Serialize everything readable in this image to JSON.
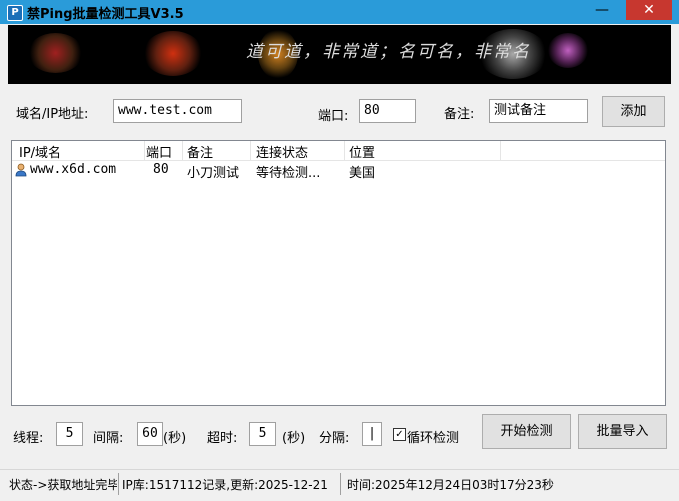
{
  "window": {
    "title": "禁Ping批量检测工具V3.5",
    "icon_letter": "P",
    "minimize": "—",
    "close": "✕"
  },
  "banner": {
    "calligraphy": "道可道，非常道；名可名，非常名"
  },
  "form": {
    "domain_label": "域名/IP地址:",
    "domain_value": "www.test.com",
    "port_label": "端口:",
    "port_value": "80",
    "remark_label": "备注:",
    "remark_value": "测试备注",
    "add_button": "添加"
  },
  "table": {
    "columns": [
      "IP/域名",
      "端口",
      "备注",
      "连接状态",
      "位置"
    ],
    "rows": [
      {
        "host": "www.x6d.com",
        "port": "80",
        "remark": "小刀测试",
        "status": "等待检测...",
        "location": "美国"
      }
    ]
  },
  "controls": {
    "threads_label": "线程:",
    "threads_value": "5",
    "interval_label": "间隔:",
    "interval_value": "60",
    "interval_unit": "(秒)",
    "timeout_label": "超时:",
    "timeout_value": "5",
    "timeout_unit": "(秒)",
    "split_label": "分隔:",
    "split_value": "|",
    "loop_checkbox_mark": "✓",
    "loop_label": "循环检测",
    "start_button": "开始检测",
    "import_button": "批量导入"
  },
  "status": {
    "state": "状态->获取地址完毕",
    "ipdb": "IP库:1517112记录,更新:2025-12-21",
    "time": "时间:2025年12月24日03时17分23秒"
  },
  "colors": {
    "titlebar": "#2a9bd9",
    "close": "#c7372f",
    "banner_bg": "#000000"
  }
}
